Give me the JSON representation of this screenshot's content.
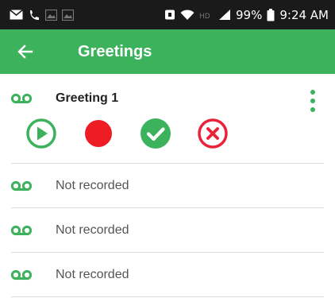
{
  "status_bar": {
    "battery_percent": "99%",
    "time": "9:24 AM",
    "icons": [
      "mail-icon",
      "missed-call-icon",
      "gallery-icon",
      "gallery-icon",
      "alarm-icon",
      "wifi-icon",
      "hd-icon",
      "signal-icon",
      "battery-icon"
    ]
  },
  "app_bar": {
    "title": "Greetings",
    "back_icon": "arrow-left-icon",
    "color": "#3bb25b"
  },
  "greetings": {
    "active": {
      "name": "Greeting 1",
      "icon": "voicemail-icon",
      "actions": [
        "play-icon",
        "record-icon",
        "confirm-icon",
        "delete-icon"
      ]
    },
    "empty_items": [
      {
        "label": "Not recorded",
        "icon": "voicemail-icon"
      },
      {
        "label": "Not recorded",
        "icon": "voicemail-icon"
      },
      {
        "label": "Not recorded",
        "icon": "voicemail-icon"
      }
    ]
  },
  "colors": {
    "accent": "#3bb25b",
    "record": "#ee1c24",
    "delete": "#e8233a"
  }
}
